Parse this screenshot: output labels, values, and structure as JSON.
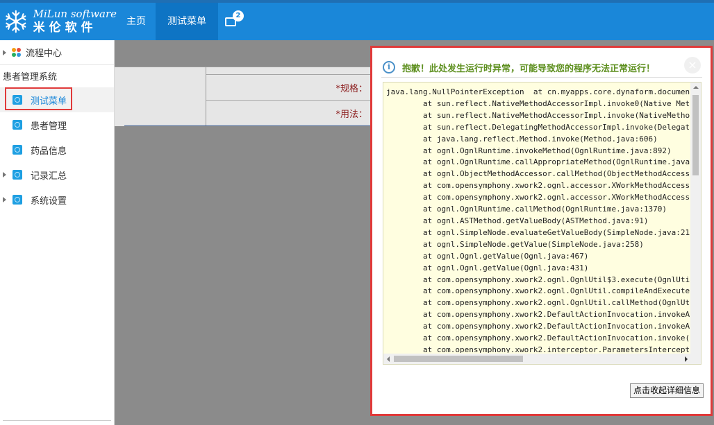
{
  "header": {
    "logo_en": "MiLun software",
    "logo_cn": "米伦软件",
    "tabs": [
      {
        "label": "主页"
      },
      {
        "label": "测试菜单",
        "active": true
      }
    ],
    "message_badge": "2"
  },
  "sidebar": {
    "top_item": "流程中心",
    "group_title": "患者管理系统",
    "items": [
      {
        "label": "测试菜单",
        "selected": true
      },
      {
        "label": "患者管理"
      },
      {
        "label": "药品信息"
      },
      {
        "label": "记录汇总",
        "expandable": true
      },
      {
        "label": "系统设置",
        "expandable": true
      }
    ]
  },
  "form": {
    "spec_label": "*规格：",
    "usage_label": "*用法："
  },
  "dialog": {
    "title": "抱歉！此处发生运行时异常，可能导致您的程序无法正常运行！",
    "trace": "java.lang.NullPointerException  at cn.myapps.core.dynaform.document\n\tat sun.reflect.NativeMethodAccessorImpl.invoke0(Native Met\n\tat sun.reflect.NativeMethodAccessorImpl.invoke(NativeMetho\n\tat sun.reflect.DelegatingMethodAccessorImpl.invoke(Delegat\n\tat java.lang.reflect.Method.invoke(Method.java:606)\n\tat ognl.OgnlRuntime.invokeMethod(OgnlRuntime.java:892)\n\tat ognl.OgnlRuntime.callAppropriateMethod(OgnlRuntime.java\n\tat ognl.ObjectMethodAccessor.callMethod(ObjectMethodAccess\n\tat com.opensymphony.xwork2.ognl.accessor.XWorkMethodAccess\n\tat com.opensymphony.xwork2.ognl.accessor.XWorkMethodAccess\n\tat ognl.OgnlRuntime.callMethod(OgnlRuntime.java:1370)\n\tat ognl.ASTMethod.getValueBody(ASTMethod.java:91)\n\tat ognl.SimpleNode.evaluateGetValueBody(SimpleNode.java:21\n\tat ognl.SimpleNode.getValue(SimpleNode.java:258)\n\tat ognl.Ognl.getValue(Ognl.java:467)\n\tat ognl.Ognl.getValue(Ognl.java:431)\n\tat com.opensymphony.xwork2.ognl.OgnlUtil$3.execute(OgnlUti\n\tat com.opensymphony.xwork2.ognl.OgnlUtil.compileAndExecute\n\tat com.opensymphony.xwork2.ognl.OgnlUtil.callMethod(OgnlUt\n\tat com.opensymphony.xwork2.DefaultActionInvocation.invokeA\n\tat com.opensymphony.xwork2.DefaultActionInvocation.invokeA\n\tat com.opensymphony.xwork2.DefaultActionInvocation.invoke(\n\tat com.opensymphony.xwork2.interceptor.ParametersIntercept",
    "collapse_button": "点击收起详细信息"
  },
  "colors": {
    "header_bg": "#1a87d9",
    "active_tab_bg": "#0e74c4",
    "highlight_border": "#e03a3a",
    "dialog_title": "#5d8f1e",
    "trace_bg": "#fffee0",
    "overlay": "#8b8b8b"
  },
  "icons": {
    "logo": "snowflake-logo-icon",
    "message": "message-icon",
    "flow": "flow-center-icon",
    "menu": "menu-item-icon",
    "info": "info-icon",
    "close": "close-icon"
  }
}
